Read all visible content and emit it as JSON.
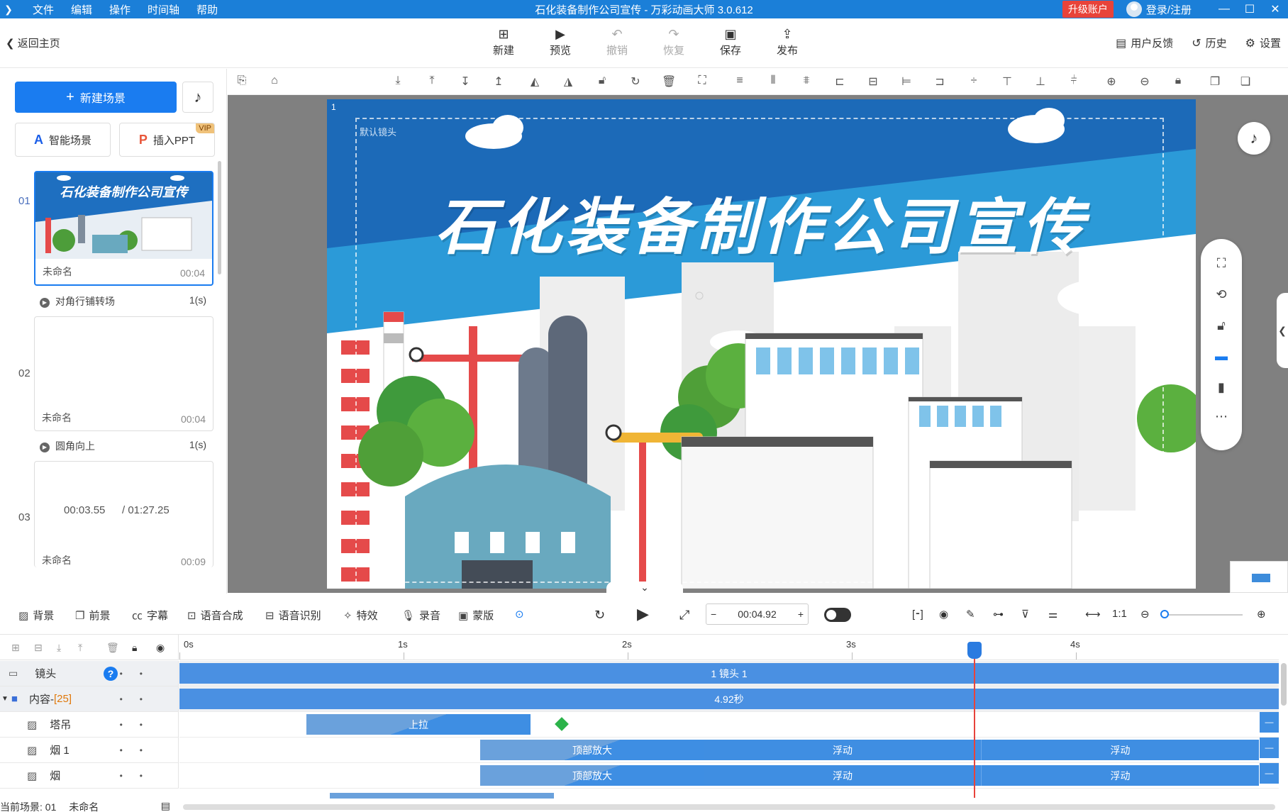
{
  "titlebar": {
    "menu": [
      "文件",
      "编辑",
      "操作",
      "时间轴",
      "帮助"
    ],
    "title": "石化装备制作公司宣传 - 万彩动画大师 3.0.612",
    "upgrade": "升级账户",
    "login": "登录/注册"
  },
  "toolbar": {
    "back": "返回主页",
    "tools": [
      {
        "label": "新建",
        "icon": "plus-box-icon"
      },
      {
        "label": "预览",
        "icon": "play-icon"
      },
      {
        "label": "撤销",
        "icon": "undo-icon"
      },
      {
        "label": "恢复",
        "icon": "redo-icon"
      },
      {
        "label": "保存",
        "icon": "save-icon"
      },
      {
        "label": "发布",
        "icon": "publish-icon"
      }
    ],
    "feedback": "用户反馈",
    "history": "历史",
    "settings": "设置"
  },
  "left": {
    "new_scene": "新建场景",
    "smart_scene": "智能场景",
    "insert_ppt": "插入PPT",
    "vip": "VIP",
    "scenes": [
      {
        "num": "01",
        "name": "未命名",
        "duration": "00:04",
        "transition": "对角行铺转场",
        "tdur": "1(s)",
        "thumb_title": "石化装备制作公司宣传"
      },
      {
        "num": "02",
        "name": "未命名",
        "duration": "00:04",
        "transition": "圆角向上",
        "tdur": "1(s)"
      },
      {
        "num": "03",
        "name": "未命名",
        "duration": "00:09"
      }
    ],
    "current_time": "00:03.55",
    "total_time": "/ 01:27.25"
  },
  "stage": {
    "num": "1",
    "camera": "默认镜头",
    "title": "石化装备制作公司宣传"
  },
  "timeline_bar": {
    "tools": [
      "背景",
      "前景",
      "字幕",
      "语音合成",
      "语音识别",
      "特效",
      "录音",
      "蒙版"
    ],
    "time": "00:04.92",
    "minus": "−",
    "plus": "+"
  },
  "timeline": {
    "ruler": [
      "0s",
      "1s",
      "2s",
      "3s",
      "4s"
    ],
    "tracks": [
      {
        "label": "镜头",
        "type": "camera"
      },
      {
        "label": "内容-",
        "count": "[25]",
        "type": "folder"
      },
      {
        "label": "塔吊",
        "type": "image"
      },
      {
        "label": "烟 1",
        "type": "image"
      },
      {
        "label": "烟",
        "type": "image"
      }
    ],
    "camera_clip": "1 镜头 1",
    "content_clip": "4.92秒",
    "crane_clip": "上拉",
    "smoke1_clips": [
      "顶部放大",
      "浮动",
      "浮动"
    ],
    "smoke_clips": [
      "顶部放大",
      "浮动",
      "浮动"
    ]
  },
  "status": {
    "current": "当前场景: 01",
    "name": "未命名"
  }
}
